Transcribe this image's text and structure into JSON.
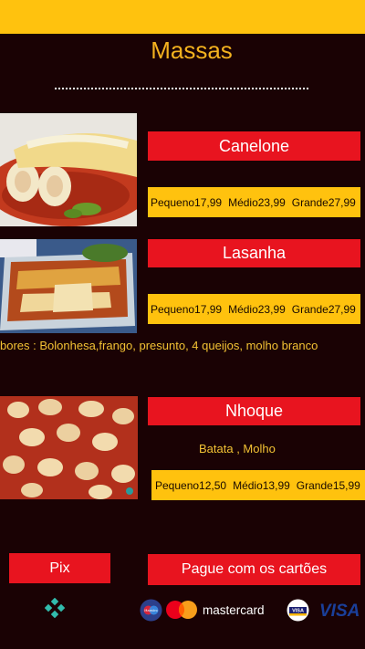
{
  "header": {
    "title": "Massas"
  },
  "products": [
    {
      "name": "Canelone",
      "prices": [
        "Pequeno17,99",
        "Médio23,99",
        "Grande27,99"
      ]
    },
    {
      "name": "Lasanha",
      "prices": [
        "Pequeno17,99",
        "Médio23,99",
        "Grande27,99"
      ],
      "flavors": "bores : Bolonhesa,frango, presunto, 4 queijos, molho branco"
    },
    {
      "name": "Nhoque",
      "subtitle": "Batata , Molho",
      "prices": [
        "Pequeno12,50",
        "Médio13,99",
        "Grande15,99"
      ]
    }
  ],
  "payment": {
    "pix_label": "Pix",
    "cards_label": "Pague com os cartões",
    "brands": {
      "maestro": "Maestro",
      "mastercard": "mastercard",
      "visa_small": "VISA",
      "visa_big": "VISA"
    }
  },
  "colors": {
    "accent": "#ffc20e",
    "button": "#e8141f",
    "background": "#1a0204"
  },
  "icons": [
    "pix-icon",
    "maestro-icon",
    "mastercard-icon",
    "visa-badge-icon",
    "visa-logo-icon"
  ]
}
